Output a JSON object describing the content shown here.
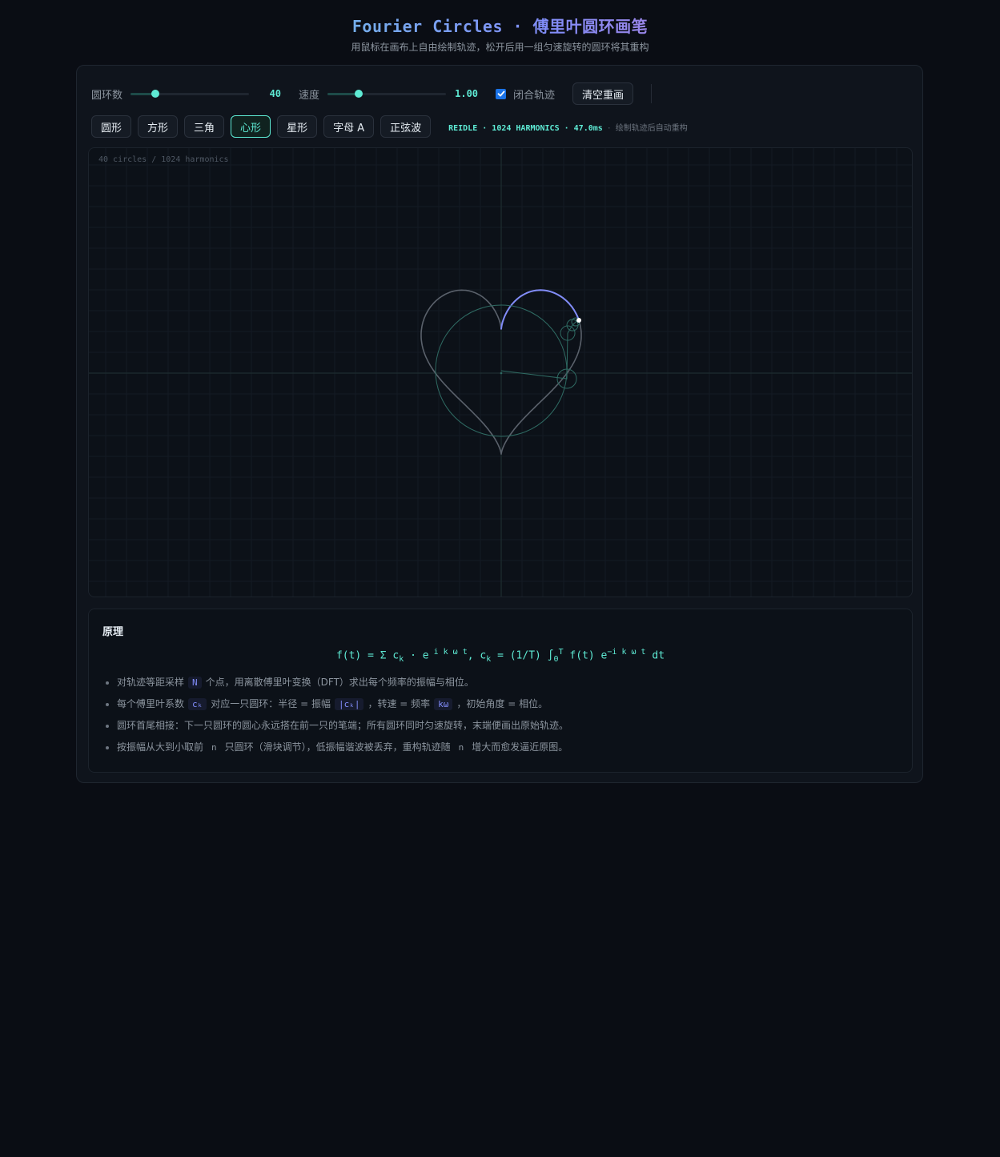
{
  "header": {
    "title": "Fourier Circles · 傅里叶圆环画笔",
    "subtitle": "用鼠标在画布上自由绘制轨迹，松开后用一组匀速旋转的圆环将其重构"
  },
  "controls": {
    "circles_label": "圆环数",
    "circles_value": "40",
    "circles_fraction": 0.21,
    "speed_label": "速度",
    "speed_value": "1.00",
    "speed_fraction": 0.26,
    "closed_label": "闭合轨迹",
    "closed_checked": true,
    "clear_label": "清空重画"
  },
  "presets": {
    "items": [
      "圆形",
      "方形",
      "三角",
      "心形",
      "星形",
      "字母 A",
      "正弦波"
    ],
    "active": "心形"
  },
  "status": {
    "main": "REIDLE · 1024 HARMONICS · 47.0ms",
    "hint": "绘制轨迹后自动重构"
  },
  "canvas": {
    "caption": "40 circles / 1024 harmonics",
    "shape": "heart",
    "harmonics": 1024,
    "circles": 40,
    "colors": {
      "grid": "#141b24",
      "axis": "#1e2e30",
      "trace": "#5a616b",
      "drawn": "#818cf8",
      "circle": "#2f6b63",
      "pen": "#ffffff"
    }
  },
  "theory": {
    "title": "原理",
    "formula": {
      "lhs": "f(t) = Σ c",
      "k1": "k",
      "mid": " · e",
      "exp1": " i k ω t",
      "sep": ",   c",
      "k2": "k",
      "rhs": " = (1/T) ∫",
      "lower": "0",
      "upper": "T",
      "rhs2": " f(t) e",
      "exp2": "−i k ω t",
      "end": " dt"
    },
    "bullets": [
      {
        "a": "对轨迹等距采样",
        "code": "N",
        "b": "个点，用离散傅里叶变换（DFT）求出每个频率的振幅与相位。"
      },
      {
        "a": "每个傅里叶系数",
        "code": "cₖ",
        "b": "对应一只圆环：半径 = 振幅",
        "code2": "|cₖ|",
        "c": "，转速 = 频率",
        "code3": "kω",
        "d": "，初始角度 = 相位。"
      },
      {
        "a": "圆环首尾相接：下一只圆环的圆心永远搭在前一只的笔端；所有圆环同时匀速旋转，末端便画出原始轨迹。"
      },
      {
        "a": "按振幅从大到小取前",
        "code": "n",
        "b": "只圆环（滑块调节），低振幅谐波被丢弃，重构轨迹随",
        "code2": "n",
        "c": "增大而愈发逼近原图。"
      }
    ]
  }
}
